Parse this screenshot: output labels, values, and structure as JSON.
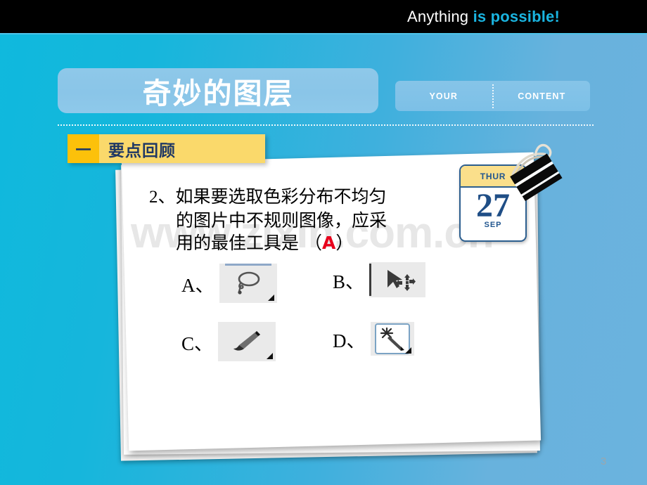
{
  "banner": {
    "text_white": "Anything ",
    "text_accent": "is possible!",
    "accent_color": "#1ab4e0"
  },
  "title": {
    "text": "奇妙的图层"
  },
  "tabs": [
    {
      "label": "YOUR"
    },
    {
      "label": "CONTENT"
    }
  ],
  "section": {
    "number": "一",
    "label": "要点回顾",
    "tab_color": "#fad96b",
    "number_color": "#fcc10a",
    "text_color": "#1f3864"
  },
  "watermark": {
    "text": "www.zixin.com.cn"
  },
  "question": {
    "number": "2、",
    "line1": "如果要选取色彩分布不均匀",
    "line2": "的图片中不规则图像，应采",
    "line3_prefix": "用的最佳工具是 （",
    "answer": "A",
    "line3_suffix": "）",
    "answer_color": "#e8001c"
  },
  "options": [
    {
      "label": "A、",
      "icon": "lasso-tool-icon"
    },
    {
      "label": "B、",
      "icon": "move-tool-icon"
    },
    {
      "label": "C、",
      "icon": "brush-tool-icon"
    },
    {
      "label": "D、",
      "icon": "magic-wand-tool-icon"
    }
  ],
  "calendar": {
    "weekday": "THUR",
    "day": "27",
    "month": "SEP",
    "header_color": "#fadf8b",
    "border_color": "#2d5f8f",
    "text_color": "#1f4e86"
  },
  "footer": {
    "page_number": "3"
  },
  "theme": {
    "background_left": "#0fb9dd",
    "background_right": "#6bb3de",
    "banner_background": "#000000",
    "title_pill": "#8ac5e8"
  }
}
